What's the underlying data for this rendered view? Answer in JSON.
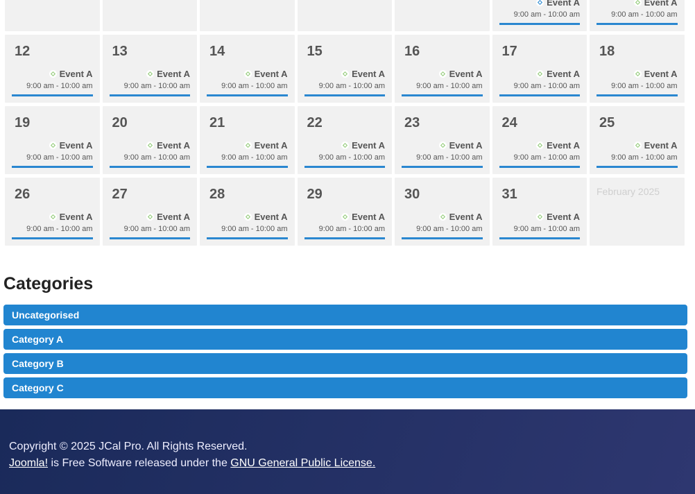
{
  "calendar": {
    "colors": {
      "accent": "#2185d0",
      "event_icon_green": "#8cc870",
      "event_icon_blue": "#2185d0"
    },
    "weeks": [
      [
        {
          "day": "",
          "events": []
        },
        {
          "day": "",
          "events": []
        },
        {
          "day": "",
          "events": []
        },
        {
          "day": "",
          "events": []
        },
        {
          "day": "",
          "events": []
        },
        {
          "day": "",
          "events": [
            {
              "title": "Event A",
              "time": "9:00 am - 10:00 am",
              "icon": "blue"
            }
          ]
        },
        {
          "day": "",
          "events": [
            {
              "title": "Event A",
              "time": "9:00 am - 10:00 am",
              "icon": "green"
            }
          ]
        }
      ],
      [
        {
          "day": "12",
          "events": [
            {
              "title": "Event A",
              "time": "9:00 am - 10:00 am",
              "icon": "green"
            }
          ]
        },
        {
          "day": "13",
          "events": [
            {
              "title": "Event A",
              "time": "9:00 am - 10:00 am",
              "icon": "green"
            }
          ]
        },
        {
          "day": "14",
          "events": [
            {
              "title": "Event A",
              "time": "9:00 am - 10:00 am",
              "icon": "green"
            }
          ]
        },
        {
          "day": "15",
          "events": [
            {
              "title": "Event A",
              "time": "9:00 am - 10:00 am",
              "icon": "green"
            }
          ]
        },
        {
          "day": "16",
          "events": [
            {
              "title": "Event A",
              "time": "9:00 am - 10:00 am",
              "icon": "green"
            }
          ]
        },
        {
          "day": "17",
          "events": [
            {
              "title": "Event A",
              "time": "9:00 am - 10:00 am",
              "icon": "green"
            }
          ]
        },
        {
          "day": "18",
          "events": [
            {
              "title": "Event A",
              "time": "9:00 am - 10:00 am",
              "icon": "green"
            }
          ]
        }
      ],
      [
        {
          "day": "19",
          "events": [
            {
              "title": "Event A",
              "time": "9:00 am - 10:00 am",
              "icon": "green"
            }
          ]
        },
        {
          "day": "20",
          "events": [
            {
              "title": "Event A",
              "time": "9:00 am - 10:00 am",
              "icon": "green"
            }
          ]
        },
        {
          "day": "21",
          "events": [
            {
              "title": "Event A",
              "time": "9:00 am - 10:00 am",
              "icon": "green"
            }
          ]
        },
        {
          "day": "22",
          "events": [
            {
              "title": "Event A",
              "time": "9:00 am - 10:00 am",
              "icon": "green"
            }
          ]
        },
        {
          "day": "23",
          "events": [
            {
              "title": "Event A",
              "time": "9:00 am - 10:00 am",
              "icon": "green"
            }
          ]
        },
        {
          "day": "24",
          "events": [
            {
              "title": "Event A",
              "time": "9:00 am - 10:00 am",
              "icon": "green"
            }
          ]
        },
        {
          "day": "25",
          "events": [
            {
              "title": "Event A",
              "time": "9:00 am - 10:00 am",
              "icon": "green"
            }
          ]
        }
      ],
      [
        {
          "day": "26",
          "events": [
            {
              "title": "Event A",
              "time": "9:00 am - 10:00 am",
              "icon": "green"
            }
          ]
        },
        {
          "day": "27",
          "events": [
            {
              "title": "Event A",
              "time": "9:00 am - 10:00 am",
              "icon": "green"
            }
          ]
        },
        {
          "day": "28",
          "events": [
            {
              "title": "Event A",
              "time": "9:00 am - 10:00 am",
              "icon": "green"
            }
          ]
        },
        {
          "day": "29",
          "events": [
            {
              "title": "Event A",
              "time": "9:00 am - 10:00 am",
              "icon": "green"
            }
          ]
        },
        {
          "day": "30",
          "events": [
            {
              "title": "Event A",
              "time": "9:00 am - 10:00 am",
              "icon": "green"
            }
          ]
        },
        {
          "day": "31",
          "events": [
            {
              "title": "Event A",
              "time": "9:00 am - 10:00 am",
              "icon": "green"
            }
          ]
        },
        {
          "day": "",
          "other_month": "February 2025",
          "events": []
        }
      ]
    ]
  },
  "categories": {
    "heading": "Categories",
    "items": [
      "Uncategorised",
      "Category A",
      "Category B",
      "Category C"
    ]
  },
  "footer": {
    "copyright": "Copyright © 2025 JCal Pro. All Rights Reserved.",
    "joomla_link": "Joomla!",
    "middle_text": " is Free Software released under the ",
    "license_link": "GNU General Public License."
  }
}
